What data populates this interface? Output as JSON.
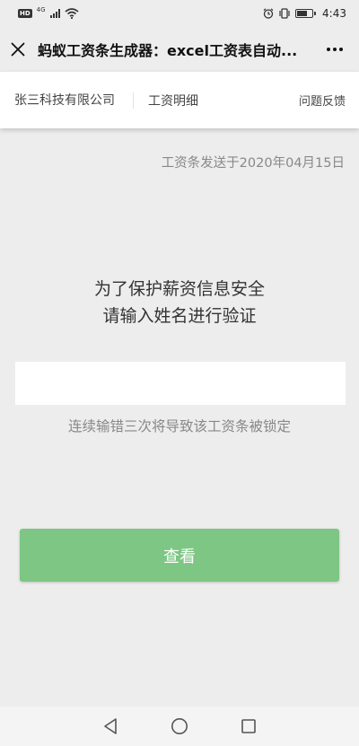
{
  "status_bar": {
    "hd_badge": "HD",
    "network": "4G",
    "time": "4:43",
    "icons": [
      "hd-icon",
      "signal-icon",
      "wifi-icon",
      "alarm-icon",
      "vibrate-icon",
      "battery-icon"
    ],
    "battery_level": 0.7
  },
  "title_bar": {
    "title": "蚂蚁工资条生成器：excel工资表自动...",
    "close_icon": "close-icon",
    "more_icon": "more-icon"
  },
  "header": {
    "company": "张三科技有限公司",
    "section": "工资明细",
    "feedback": "问题反馈"
  },
  "sent_date": "工资条发送于2020年04月15日",
  "prompt": {
    "line1": "为了保护薪资信息安全",
    "line2": "请输入姓名进行验证"
  },
  "name_input": {
    "value": "",
    "placeholder": ""
  },
  "warning": "连续输错三次将导致该工资条被锁定",
  "view_button": "查看",
  "colors": {
    "background": "#ededed",
    "button": "#7ec683",
    "muted_text": "#888888"
  },
  "nav_bar": {
    "icons": [
      "back-icon",
      "home-icon",
      "recents-icon"
    ]
  }
}
